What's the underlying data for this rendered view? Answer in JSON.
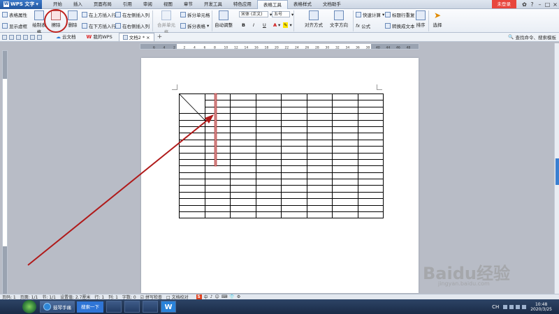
{
  "titlebar": {
    "app_name": "WPS 文字",
    "tabs": [
      "开始",
      "插入",
      "页面布局",
      "引用",
      "审阅",
      "视图",
      "章节",
      "开发工具",
      "特色应用",
      "表格工具",
      "表格样式",
      "文档助手"
    ],
    "active_tab": "表格工具",
    "login_label": "未登录"
  },
  "ribbon": {
    "table_props": "表格属性",
    "show_gridlines": "显示虚框",
    "draw_table": "绘制表格",
    "erase": "擦除",
    "delete": "删除",
    "insert_above": "在上方插入行",
    "insert_below": "在下方插入行",
    "insert_left": "在左侧插入列",
    "insert_right": "在右侧插入列",
    "merge_cells": "合并单元格",
    "split_cells": "拆分单元格",
    "split_table": "拆分表格",
    "autofit": "自动调整",
    "font_name": "宋体 (正文)",
    "font_size": "五号",
    "bold": "B",
    "italic": "I",
    "underline": "U",
    "font_color": "A",
    "align": "对齐方式",
    "text_direction": "文字方向",
    "quick_calc": "快速计算",
    "formula": "公式",
    "repeat_header": "标题行重复",
    "convert_text": "转换成文本",
    "sort": "排序",
    "select": "选择"
  },
  "qbar": {
    "tabs": [
      "云文档",
      "我的WPS",
      "文档2 *"
    ],
    "active_doc": "文档2 *",
    "search_label": "查找命令、搜索模板"
  },
  "ruler": {
    "labels": [
      "6",
      "4",
      "2",
      "2",
      "4",
      "6",
      "8",
      "10",
      "12",
      "14",
      "16",
      "18",
      "20",
      "22",
      "24",
      "26",
      "28",
      "30",
      "32",
      "34",
      "36",
      "38",
      "40",
      "44",
      "46",
      "48"
    ]
  },
  "table": {
    "rows": 19,
    "cols": 8
  },
  "status": {
    "page_no": "页码: 1",
    "pages": "页面: 1/1",
    "section": "节: 1/1",
    "setting": "设置值: 2.7厘米",
    "row": "行: 1",
    "col": "列: 1",
    "words": "字数: 0",
    "spellcheck": "拼写检查",
    "proofread": "文档校对",
    "ime_items": [
      "中",
      "♪",
      "☺",
      "⌨",
      "👕",
      "⚙"
    ]
  },
  "taskbar": {
    "window_label": "鼓琴手痛",
    "search_label": "搜索一下",
    "time": "10:48",
    "date": "2020/3/25",
    "lang": "CH"
  },
  "watermark": {
    "brand": "Baidu经验",
    "url": "jingyan.baidu.com"
  },
  "colors": {
    "accent": "#2a62b0",
    "annotation": "#b01a1a",
    "login": "#e8453c"
  }
}
